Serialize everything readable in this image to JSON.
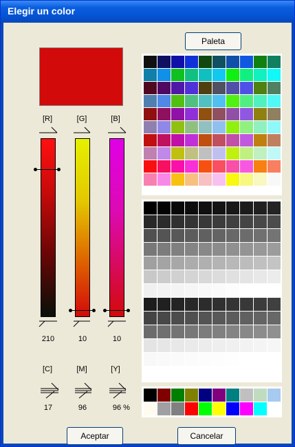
{
  "title": "Elegir un color",
  "buttons": {
    "palette": "Paleta",
    "accept": "Aceptar",
    "cancel": "Cancelar"
  },
  "preview_color": "#d20a0a",
  "rgb": [
    {
      "label": "[R]",
      "value": "210"
    },
    {
      "label": "[G]",
      "value": "10"
    },
    {
      "label": "[B]",
      "value": "10"
    }
  ],
  "cmy": [
    {
      "label": "[C]",
      "value": "17"
    },
    {
      "label": "[M]",
      "value": "96"
    },
    {
      "label": "[Y]",
      "value": "96"
    }
  ],
  "percent_sign": "%",
  "palette_top": [
    "#101010",
    "#101060",
    "#1010a8",
    "#1030d8",
    "#104810",
    "#105060",
    "#1050a8",
    "#1058e0",
    "#108010",
    "#108060",
    "#1080a8",
    "#1090e8",
    "#10c020",
    "#10c080",
    "#10c0c0",
    "#10c8f0",
    "#10f010",
    "#10f080",
    "#10f0c0",
    "#10f8f8",
    "#500820",
    "#500860",
    "#5018a8",
    "#5030d8",
    "#504010",
    "#505060",
    "#5050a8",
    "#5050e8",
    "#508010",
    "#508060",
    "#5080b0",
    "#5088e8",
    "#50c010",
    "#50c080",
    "#50c0c0",
    "#50c0f0",
    "#50f010",
    "#50f080",
    "#50f0c0",
    "#50f8f8",
    "#901010",
    "#901060",
    "#9010a8",
    "#9030d8",
    "#905010",
    "#905060",
    "#9050a8",
    "#9058e0",
    "#908010",
    "#908060",
    "#9080b0",
    "#9088e8",
    "#90c010",
    "#90c080",
    "#90c0c0",
    "#90c0f0",
    "#90f010",
    "#90f080",
    "#90f0c0",
    "#90f8f8",
    "#c01010",
    "#c01060",
    "#c010a8",
    "#c030d8",
    "#c05010",
    "#c05060",
    "#c050a8",
    "#c058e0",
    "#c08010",
    "#c08060",
    "#c080b0",
    "#c088e8",
    "#c0c010",
    "#c0c080",
    "#c0c0c0",
    "#c0c0f0",
    "#c0f010",
    "#c0f080",
    "#c0f0c0",
    "#c0f8f8",
    "#f81010",
    "#f81060",
    "#f810a8",
    "#f830d8",
    "#f85010",
    "#f85060",
    "#f850a8",
    "#f858e0",
    "#f88010",
    "#f88060",
    "#f880b0",
    "#f888e8",
    "#f8c010",
    "#f8c080",
    "#f8c0c0",
    "#f8c0f0",
    "#f8f810",
    "#f8f880",
    "#f8f8c0",
    "#f8f8f8"
  ],
  "palette_gray": [
    "#000000",
    "#040404",
    "#080808",
    "#0c0c0c",
    "#101010",
    "#141414",
    "#181818",
    "#1c1c1c",
    "#202020",
    "#242424",
    "#282828",
    "#2c2c2c",
    "#303030",
    "#343434",
    "#383838",
    "#3c3c3c",
    "#404040",
    "#444444",
    "#484848",
    "#4c4c4c",
    "#505050",
    "#545454",
    "#585858",
    "#5c5c5c",
    "#606060",
    "#646464",
    "#686868",
    "#6c6c6c",
    "#707070",
    "#747474",
    "#787878",
    "#7c7c7c",
    "#808080",
    "#848484",
    "#888888",
    "#8c8c8c",
    "#909090",
    "#949494",
    "#989898",
    "#9c9c9c",
    "#a0a0a0",
    "#a4a4a4",
    "#a8a8a8",
    "#acacac",
    "#b0b0b0",
    "#b4b4b4",
    "#b8b8b8",
    "#bcbcbc",
    "#c0c0c0",
    "#c4c4c4",
    "#c8c8c8",
    "#cccccc",
    "#d0d0d0",
    "#d4d4d4",
    "#d8d8d8",
    "#dcdcdc",
    "#e0e0e0",
    "#e4e4e4",
    "#e8e8e8",
    "#ececec",
    "#f0f0f0",
    "#f2f2f2",
    "#f4f4f4",
    "#f6f6f6",
    "#f8f8f8",
    "#fafafa",
    "#fcfcfc",
    "#ffffff",
    "#ffffff",
    "#ffffff",
    "#1c1c1c",
    "#202020",
    "#242424",
    "#282828",
    "#2c2c2c",
    "#303030",
    "#343434",
    "#383838",
    "#3c3c3c",
    "#404040",
    "#444444",
    "#484848",
    "#4c4c4c",
    "#505050",
    "#545454",
    "#585858",
    "#5c5c5c",
    "#606060",
    "#646464",
    "#686868",
    "#6c6c6c",
    "#707070",
    "#747474",
    "#787878",
    "#7c7c7c",
    "#808080",
    "#848484",
    "#888888",
    "#8c8c8c",
    "#909090",
    "#e4e4e4",
    "#e6e6e6",
    "#e8e8e8",
    "#eaeaea",
    "#ececec",
    "#eeeeee",
    "#f0f0f0",
    "#f2f2f2",
    "#f4f4f4",
    "#f6f6f6",
    "#f8f8f8",
    "#f9f9f9",
    "#fafafa",
    "#fbfbfb",
    "#fcfcfc",
    "#fdfdfd",
    "#fefefe",
    "#ffffff"
  ],
  "palette_basic": [
    "#000000",
    "#800000",
    "#008000",
    "#808000",
    "#000080",
    "#800080",
    "#008080",
    "#c0c0c0",
    "#c0dcc0",
    "#a6caf0",
    "#fffbf0",
    "#a0a0a4",
    "#808080",
    "#ff0000",
    "#00ff00",
    "#ffff00",
    "#0000ff",
    "#ff00ff",
    "#00ffff",
    "#ffffff"
  ]
}
